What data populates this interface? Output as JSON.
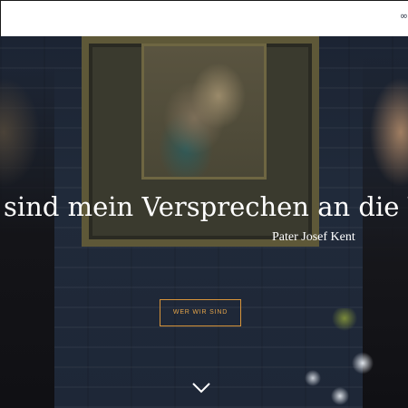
{
  "hero": {
    "quote": "sind mein Versprechen an die W",
    "author": "Pater Josef Kent",
    "cta_label": "WER WIR SIND"
  },
  "icons": {
    "logo": "logo-mark-icon",
    "scroll": "chevron-down-icon"
  },
  "colors": {
    "overlay": "#1f2838",
    "accent": "#e4a44a",
    "text": "#ffffff"
  }
}
